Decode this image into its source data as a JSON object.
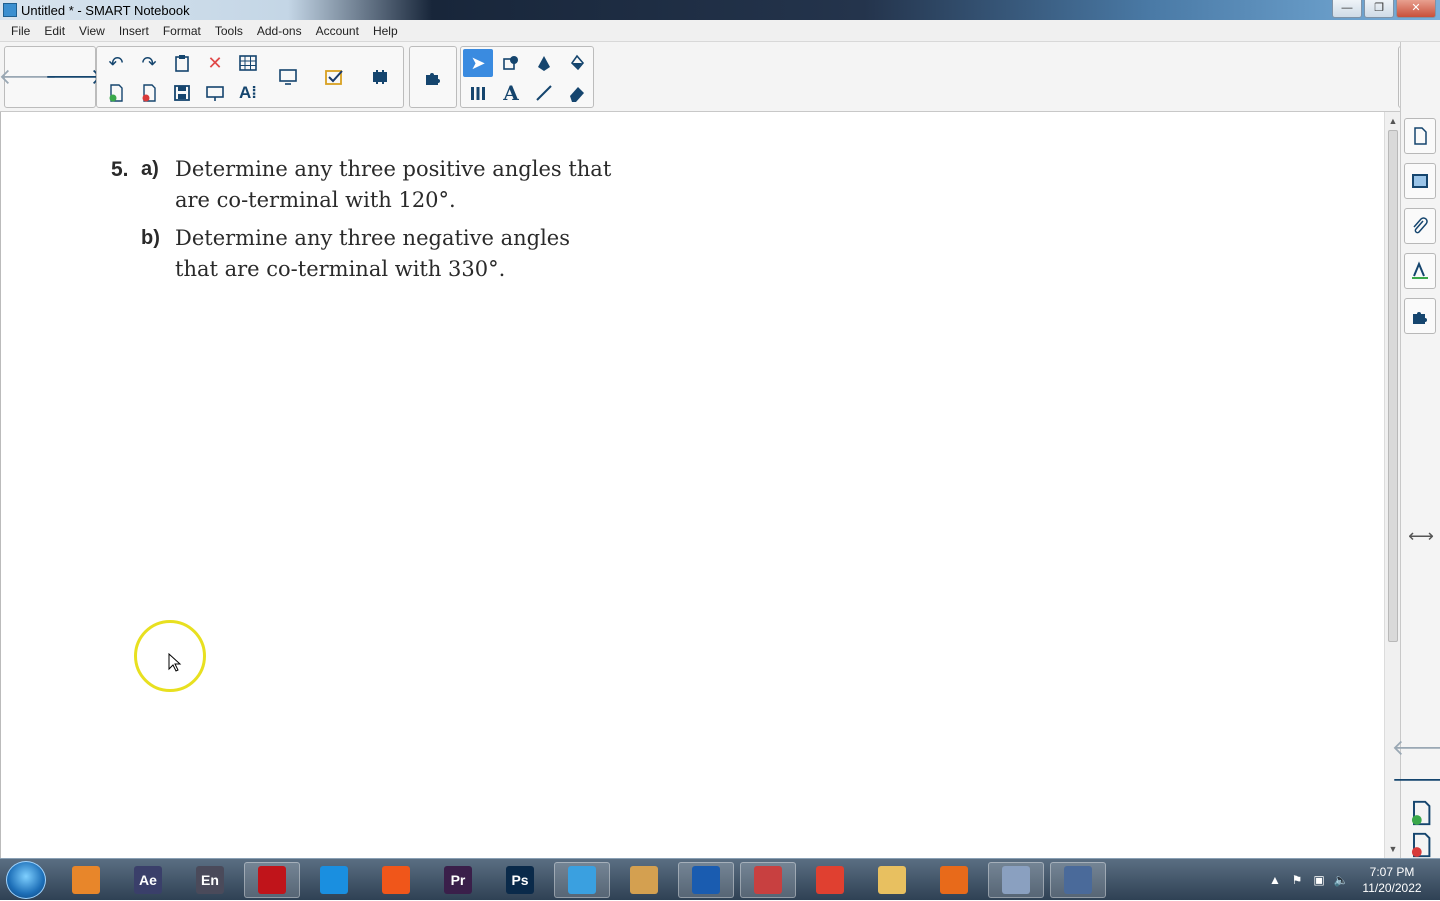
{
  "window": {
    "title": "Untitled * - SMART Notebook",
    "min": "—",
    "max": "❐",
    "close": "✕"
  },
  "menu": [
    "File",
    "Edit",
    "View",
    "Insert",
    "Format",
    "Tools",
    "Add-ons",
    "Account",
    "Help"
  ],
  "question": {
    "number": "5.",
    "a_label": "a)",
    "a_text": "Determine any three positive angles that are co-terminal with 120°.",
    "b_label": "b)",
    "b_text": "Determine any three negative angles that are co-terminal with 330°."
  },
  "taskbar": {
    "apps": [
      {
        "name": "media-player",
        "label": "",
        "color": "#e8862a"
      },
      {
        "name": "after-effects",
        "label": "Ae",
        "color": "#3a3f6a"
      },
      {
        "name": "encoder",
        "label": "En",
        "color": "#4a4a5a"
      },
      {
        "name": "acrobat",
        "label": "",
        "color": "#c0141a"
      },
      {
        "name": "messenger",
        "label": "",
        "color": "#1a8fe0"
      },
      {
        "name": "brave",
        "label": "",
        "color": "#f0561a"
      },
      {
        "name": "premiere",
        "label": "Pr",
        "color": "#3a1f4a"
      },
      {
        "name": "photoshop",
        "label": "Ps",
        "color": "#0a2a4a"
      },
      {
        "name": "smart-notebook",
        "label": "",
        "color": "#3aa0e0"
      },
      {
        "name": "paint",
        "label": "",
        "color": "#d4a050"
      },
      {
        "name": "word",
        "label": "",
        "color": "#1a5cb0"
      },
      {
        "name": "snipping-tool",
        "label": "",
        "color": "#c84040"
      },
      {
        "name": "chrome",
        "label": "",
        "color": "#e04030"
      },
      {
        "name": "explorer",
        "label": "",
        "color": "#e8c060"
      },
      {
        "name": "firefox",
        "label": "",
        "color": "#e86a1a"
      },
      {
        "name": "disc-burner",
        "label": "",
        "color": "#8aa0c0"
      },
      {
        "name": "network-app",
        "label": "",
        "color": "#4a6a9a"
      }
    ],
    "time": "7:07 PM",
    "date": "11/20/2022"
  }
}
